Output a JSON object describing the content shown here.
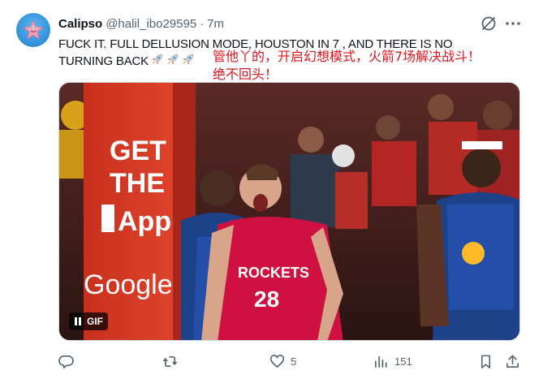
{
  "author": {
    "display_name": "Calipso",
    "handle": "@halil_ibo29595",
    "separator": "·",
    "time": "7m",
    "avatar_icon": "patrick-star-avatar"
  },
  "tweet": {
    "text": "FUCK IT. FULL DELLUSION MODE, HOUSTON IN 7 , AND THERE IS NO TURNING BACK",
    "emoji": [
      "rocket",
      "rocket",
      "rocket"
    ],
    "translation_line1": "管他丫的，开启幻想模式，火箭7场解决战斗！",
    "translation_line2": "绝不回头！",
    "translation_color": "#e0141e"
  },
  "media": {
    "type": "gif",
    "badge_label": "GIF",
    "pause_icon": "pause-icon",
    "ad_text_1": "GET",
    "ad_text_2": "THE",
    "ad_text_3": "App",
    "ad_text_4": "Google",
    "player_jersey_team": "ROCKETS",
    "player_jersey_number": "28"
  },
  "actions": {
    "reply": {
      "icon": "reply-icon",
      "count": ""
    },
    "retweet": {
      "icon": "retweet-icon",
      "count": ""
    },
    "like": {
      "icon": "heart-icon",
      "count": "5"
    },
    "views": {
      "icon": "views-icon",
      "count": "151"
    },
    "bookmark": {
      "icon": "bookmark-icon"
    },
    "share": {
      "icon": "share-icon"
    }
  },
  "colors": {
    "text_primary": "#0f1419",
    "text_secondary": "#536471",
    "border": "#cfd9de"
  }
}
